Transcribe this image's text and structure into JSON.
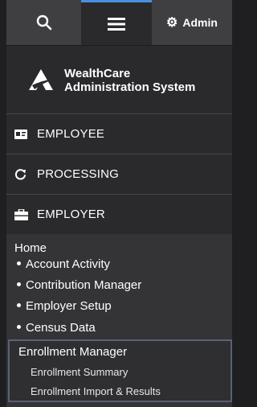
{
  "topbar": {
    "search_icon": "search-icon",
    "menu_icon": "hamburger-icon",
    "admin_label": "Admin",
    "accent_color": "#4a90e2"
  },
  "logo": {
    "line1": "WealthCare",
    "line2": "Administration System"
  },
  "sections": {
    "employee": "EMPLOYEE",
    "processing": "PROCESSING",
    "employer": "EMPLOYER"
  },
  "menu": {
    "home": "Home",
    "items": [
      "Account Activity",
      "Contribution Manager",
      "Employer Setup",
      "Census Data"
    ],
    "active": "Enrollment Manager",
    "sub_items": [
      "Enrollment Summary",
      "Enrollment Import & Results"
    ]
  }
}
